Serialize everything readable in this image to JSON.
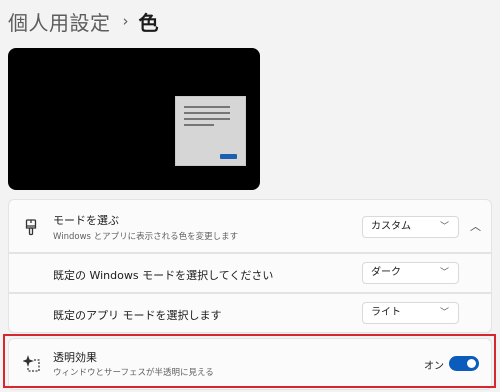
{
  "breadcrumb": {
    "parent": "個人用設定",
    "separator": "›",
    "current": "色"
  },
  "mode": {
    "title": "モードを選ぶ",
    "subtitle": "Windows とアプリに表示される色を変更します",
    "value": "カスタム",
    "icon": "brush-icon"
  },
  "windows_mode": {
    "label": "既定の Windows モードを選択してください",
    "value": "ダーク"
  },
  "app_mode": {
    "label": "既定のアプリ モードを選択します",
    "value": "ライト"
  },
  "transparency": {
    "title": "透明効果",
    "subtitle": "ウィンドウとサーフェスが半透明に見える",
    "state_label": "オン",
    "enabled": true,
    "icon": "transparency-sparkle-icon"
  },
  "colors": {
    "accent": "#0b5cbd",
    "highlight": "#d7262e"
  }
}
